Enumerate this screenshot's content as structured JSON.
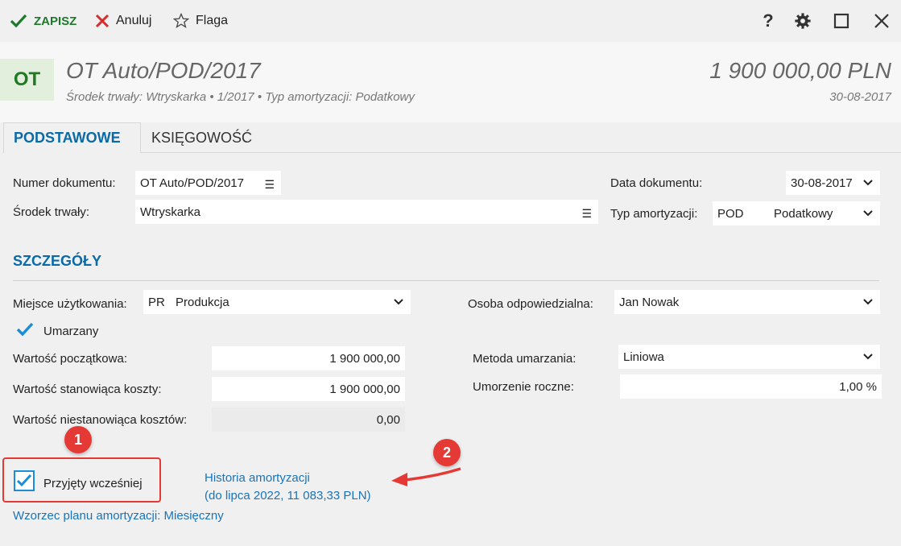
{
  "toolbar": {
    "save_label": "ZAPISZ",
    "cancel_label": "Anuluj",
    "flag_label": "Flaga",
    "help_label": "?"
  },
  "header": {
    "badge": "OT",
    "title": "OT Auto/POD/2017",
    "subtitle": "Środek trwały: Wtryskarka  •  1/2017  •  Typ amortyzacji: Podatkowy",
    "amount": "1 900 000,00 PLN",
    "date": "30-08-2017"
  },
  "tabs": [
    {
      "label": "PODSTAWOWE",
      "active": true
    },
    {
      "label": "KSIĘGOWOŚĆ",
      "active": false
    }
  ],
  "form": {
    "doc_number": {
      "label": "Numer dokumentu:",
      "value": "OT Auto/POD/2017"
    },
    "asset": {
      "label": "Środek trwały:",
      "value": "Wtryskarka"
    },
    "doc_date": {
      "label": "Data dokumentu:",
      "value": "30-08-2017"
    },
    "amort_type": {
      "label": "Typ amortyzacji:",
      "code": "POD",
      "value": "Podatkowy"
    }
  },
  "details": {
    "section_title": "SZCZEGÓŁY",
    "place": {
      "label": "Miejsce użytkowania:",
      "code": "PR",
      "value": "Produkcja"
    },
    "person": {
      "label": "Osoba odpowiedzialna:",
      "value": "Jan Nowak"
    },
    "depreciated": {
      "label": "Umarzany",
      "checked": true
    },
    "initial_value": {
      "label": "Wartość początkowa:",
      "value": "1 900 000,00"
    },
    "cost_value": {
      "label": "Wartość stanowiąca koszty:",
      "value": "1 900 000,00"
    },
    "noncost_value": {
      "label": "Wartość niestanowiąca kosztów:",
      "value": "0,00"
    },
    "method": {
      "label": "Metoda umarzania:",
      "value": "Liniowa"
    },
    "annual": {
      "label": "Umorzenie roczne:",
      "value": "1,00 %"
    },
    "accepted_earlier": {
      "label": "Przyjęty wcześniej",
      "checked": true
    },
    "history_link_1": "Historia amortyzacji",
    "history_link_2": "(do lipca 2022, 11 083,33 PLN)",
    "plan_link": "Wzorzec planu amortyzacji: Miesięczny"
  },
  "annotations": {
    "marker_1": "1",
    "marker_2": "2",
    "accent_color": "#e53935"
  }
}
